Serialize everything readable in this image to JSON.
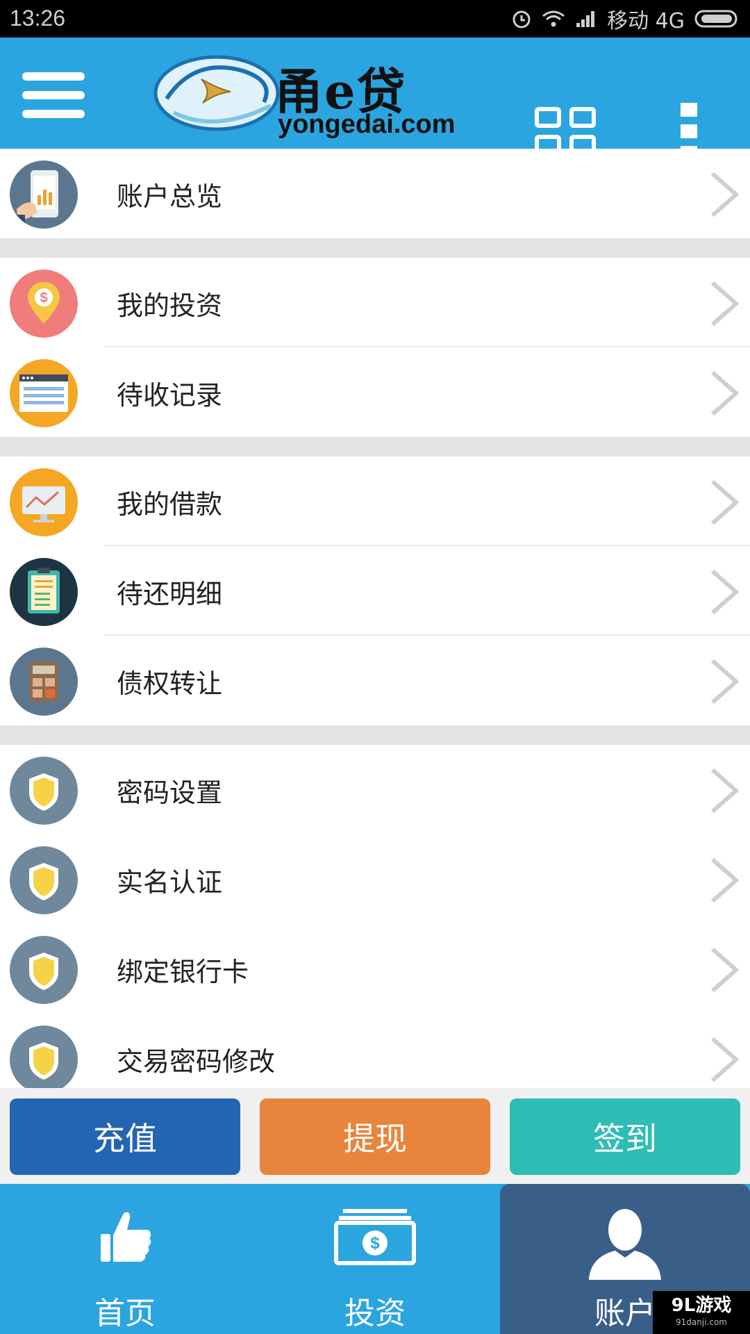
{
  "status_bar": {
    "time": "13:26",
    "carrier": "移动 4G"
  },
  "header": {
    "brand": "甬e贷",
    "domain": "yongedai.com"
  },
  "menu": {
    "account_overview": "账户总览",
    "my_investment": "我的投资",
    "pending_receipts": "待收记录",
    "my_loans": "我的借款",
    "repayment_details": "待还明细",
    "debt_transfer": "债权转让",
    "password_settings": "密码设置",
    "real_name_auth": "实名认证",
    "bind_bank_card": "绑定银行卡",
    "change_trade_password": "交易密码修改"
  },
  "actions": {
    "recharge": "充值",
    "withdraw": "提现",
    "checkin": "签到"
  },
  "bottom_nav": {
    "home": "首页",
    "invest": "投资",
    "account": "账户",
    "active": "account"
  },
  "watermark": {
    "main": "9L游戏",
    "sub": "91danji.com"
  },
  "colors": {
    "header_blue": "#2ba5e0",
    "active_tab": "#395f89",
    "recharge": "#2365b3",
    "withdraw": "#e8843c",
    "checkin": "#2cbdb5"
  }
}
